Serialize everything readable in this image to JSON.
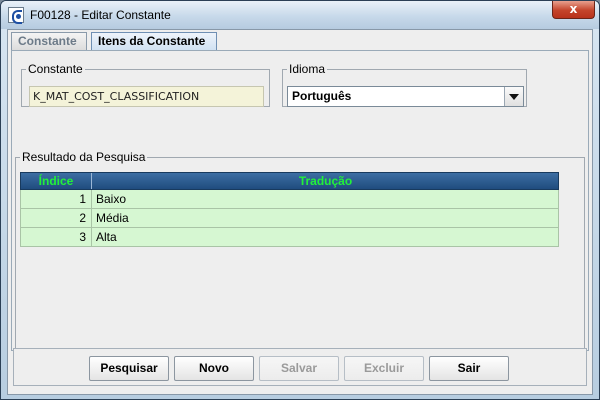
{
  "window": {
    "title": "F00128 - Editar Constante",
    "close_label": "x"
  },
  "tabs": [
    {
      "label": "Constante",
      "active": false
    },
    {
      "label": "Itens da Constante",
      "active": true
    }
  ],
  "constante": {
    "legend": "Constante",
    "value": "K_MAT_COST_CLASSIFICATION"
  },
  "idioma": {
    "legend": "Idioma",
    "selected": "Português"
  },
  "results": {
    "legend": "Resultado da Pesquisa",
    "columns": [
      "Índice",
      "Tradução"
    ],
    "rows": [
      {
        "index": "1",
        "translation": "Baixo"
      },
      {
        "index": "2",
        "translation": "Média"
      },
      {
        "index": "3",
        "translation": "Alta"
      }
    ]
  },
  "buttons": {
    "pesquisar": "Pesquisar",
    "novo": "Novo",
    "salvar": "Salvar",
    "excluir": "Excluir",
    "sair": "Sair"
  },
  "colors": {
    "header_text": "#22f03a",
    "header_bg": "#2a5a8e",
    "row_bg": "#d6f7d2",
    "close_button": "#c4442b"
  }
}
